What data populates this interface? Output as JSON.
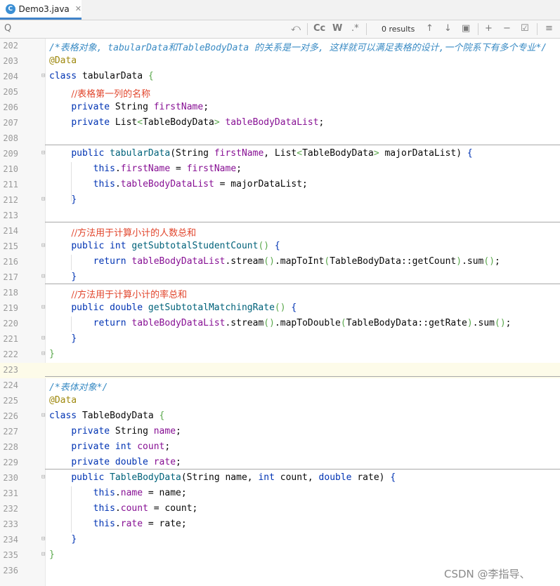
{
  "tab": {
    "file_name": "Demo3.java",
    "close_glyph": "✕",
    "file_icon": "C"
  },
  "search": {
    "search_icon": "Q",
    "regex_icon": "⤺",
    "case_label": "Cc",
    "word_label": "W",
    "regex_label": ".*",
    "results": "0 results",
    "up_icon": "↑",
    "down_icon": "↓",
    "select_icon": "▣",
    "add_icon": "+",
    "remove_icon": "−",
    "check_icon": "☑",
    "filter_icon": "≡"
  },
  "editor": {
    "lines": [
      {
        "n": "202",
        "fold": "",
        "html": "<span class='doc'>/*表格对象, tabularData和TableBodyData 的关系是一对多, 这样就可以满足表格的设计,一个院系下有多个专业*/</span>"
      },
      {
        "n": "203",
        "fold": "",
        "html": "<span class='ann'>@Data</span>"
      },
      {
        "n": "204",
        "fold": "⊟",
        "html": "<span class='kw'>class</span> tabularData <span class='par'>{</span>"
      },
      {
        "n": "205",
        "fold": "",
        "html": "    <span class='cmt-zh'>//表格第一列的名称</span>"
      },
      {
        "n": "206",
        "fold": "",
        "html": "    <span class='kw'>private</span> String <span class='fld'>firstName</span>;"
      },
      {
        "n": "207",
        "fold": "",
        "html": "    <span class='kw'>private</span> List<span class='par'>&lt;</span>TableBodyData<span class='par'>&gt;</span> <span class='fld'>tableBodyDataList</span>;"
      },
      {
        "n": "208",
        "fold": "",
        "html": ""
      },
      {
        "n": "209",
        "fold": "⊟",
        "html": "    <span class='kw'>public</span> <span class='fn'>tabularData</span>(String <span class='fld'>firstName</span>, List<span class='par'>&lt;</span>TableBodyData<span class='par'>&gt;</span> majorDataList) <span class='kw'>{</span>"
      },
      {
        "n": "210",
        "fold": "",
        "html": "        <span class='kw'>this</span>.<span class='fld'>firstName</span> = <span class='fld'>firstName</span>;"
      },
      {
        "n": "211",
        "fold": "",
        "html": "        <span class='kw'>this</span>.<span class='fld'>tableBodyDataList</span> = majorDataList;"
      },
      {
        "n": "212",
        "fold": "⊟",
        "html": "    <span class='kw'>}</span>"
      },
      {
        "n": "213",
        "fold": "",
        "html": ""
      },
      {
        "n": "214",
        "fold": "",
        "html": "    <span class='cmt-zh'>//方法用于计算小计的人数总和</span>"
      },
      {
        "n": "215",
        "fold": "⊟",
        "html": "    <span class='kw'>public int</span> <span class='fn'>getSubtotalStudentCount</span><span class='par'>()</span> <span class='kw'>{</span>"
      },
      {
        "n": "216",
        "fold": "",
        "html": "        <span class='kw'>return</span> <span class='fld'>tableBodyDataList</span>.stream<span class='par'>()</span>.mapToInt<span class='par'>(</span>TableBodyData::getCount<span class='par'>)</span>.sum<span class='par'>()</span>;"
      },
      {
        "n": "217",
        "fold": "⊟",
        "html": "    <span class='kw'>}</span>"
      },
      {
        "n": "218",
        "fold": "",
        "html": "    <span class='cmt-zh'>//方法用于计算小计的率总和</span>"
      },
      {
        "n": "219",
        "fold": "⊟",
        "html": "    <span class='kw'>public double</span> <span class='fn'>getSubtotalMatchingRate</span><span class='par'>()</span> <span class='kw'>{</span>"
      },
      {
        "n": "220",
        "fold": "",
        "html": "        <span class='kw'>return</span> <span class='fld'>tableBodyDataList</span>.stream<span class='par'>()</span>.mapToDouble<span class='par'>(</span>TableBodyData::getRate<span class='par'>)</span>.sum<span class='par'>()</span>;"
      },
      {
        "n": "221",
        "fold": "⊟",
        "html": "    <span class='kw'>}</span>"
      },
      {
        "n": "222",
        "fold": "⊟",
        "html": "<span class='par'>}</span>"
      },
      {
        "n": "223",
        "fold": "",
        "html": ""
      },
      {
        "n": "224",
        "fold": "",
        "html": "<span class='doc'>/*表体对象*/</span>"
      },
      {
        "n": "225",
        "fold": "",
        "html": "<span class='ann'>@Data</span>"
      },
      {
        "n": "226",
        "fold": "⊟",
        "html": "<span class='kw'>class</span> TableBodyData <span class='par'>{</span>"
      },
      {
        "n": "227",
        "fold": "",
        "html": "    <span class='kw'>private</span> String <span class='fld'>name</span>;"
      },
      {
        "n": "228",
        "fold": "",
        "html": "    <span class='kw'>private int</span> <span class='fld'>count</span>;"
      },
      {
        "n": "229",
        "fold": "",
        "html": "    <span class='kw'>private double</span> <span class='fld'>rate</span>;"
      },
      {
        "n": "230",
        "fold": "⊟",
        "html": "    <span class='kw'>public</span> <span class='fn'>TableBodyData</span>(String name, <span class='kw'>int</span> count, <span class='kw'>double</span> rate) <span class='kw'>{</span>"
      },
      {
        "n": "231",
        "fold": "",
        "html": "        <span class='kw'>this</span>.<span class='fld'>name</span> = name;"
      },
      {
        "n": "232",
        "fold": "",
        "html": "        <span class='kw'>this</span>.<span class='fld'>count</span> = count;"
      },
      {
        "n": "233",
        "fold": "",
        "html": "        <span class='kw'>this</span>.<span class='fld'>rate</span> = rate;"
      },
      {
        "n": "234",
        "fold": "⊟",
        "html": "    <span class='kw'>}</span>"
      },
      {
        "n": "235",
        "fold": "⊟",
        "html": "<span class='par'>}</span>"
      },
      {
        "n": "236",
        "fold": "",
        "html": ""
      }
    ],
    "current_line": "223"
  },
  "watermark": "CSDN @李指导、"
}
